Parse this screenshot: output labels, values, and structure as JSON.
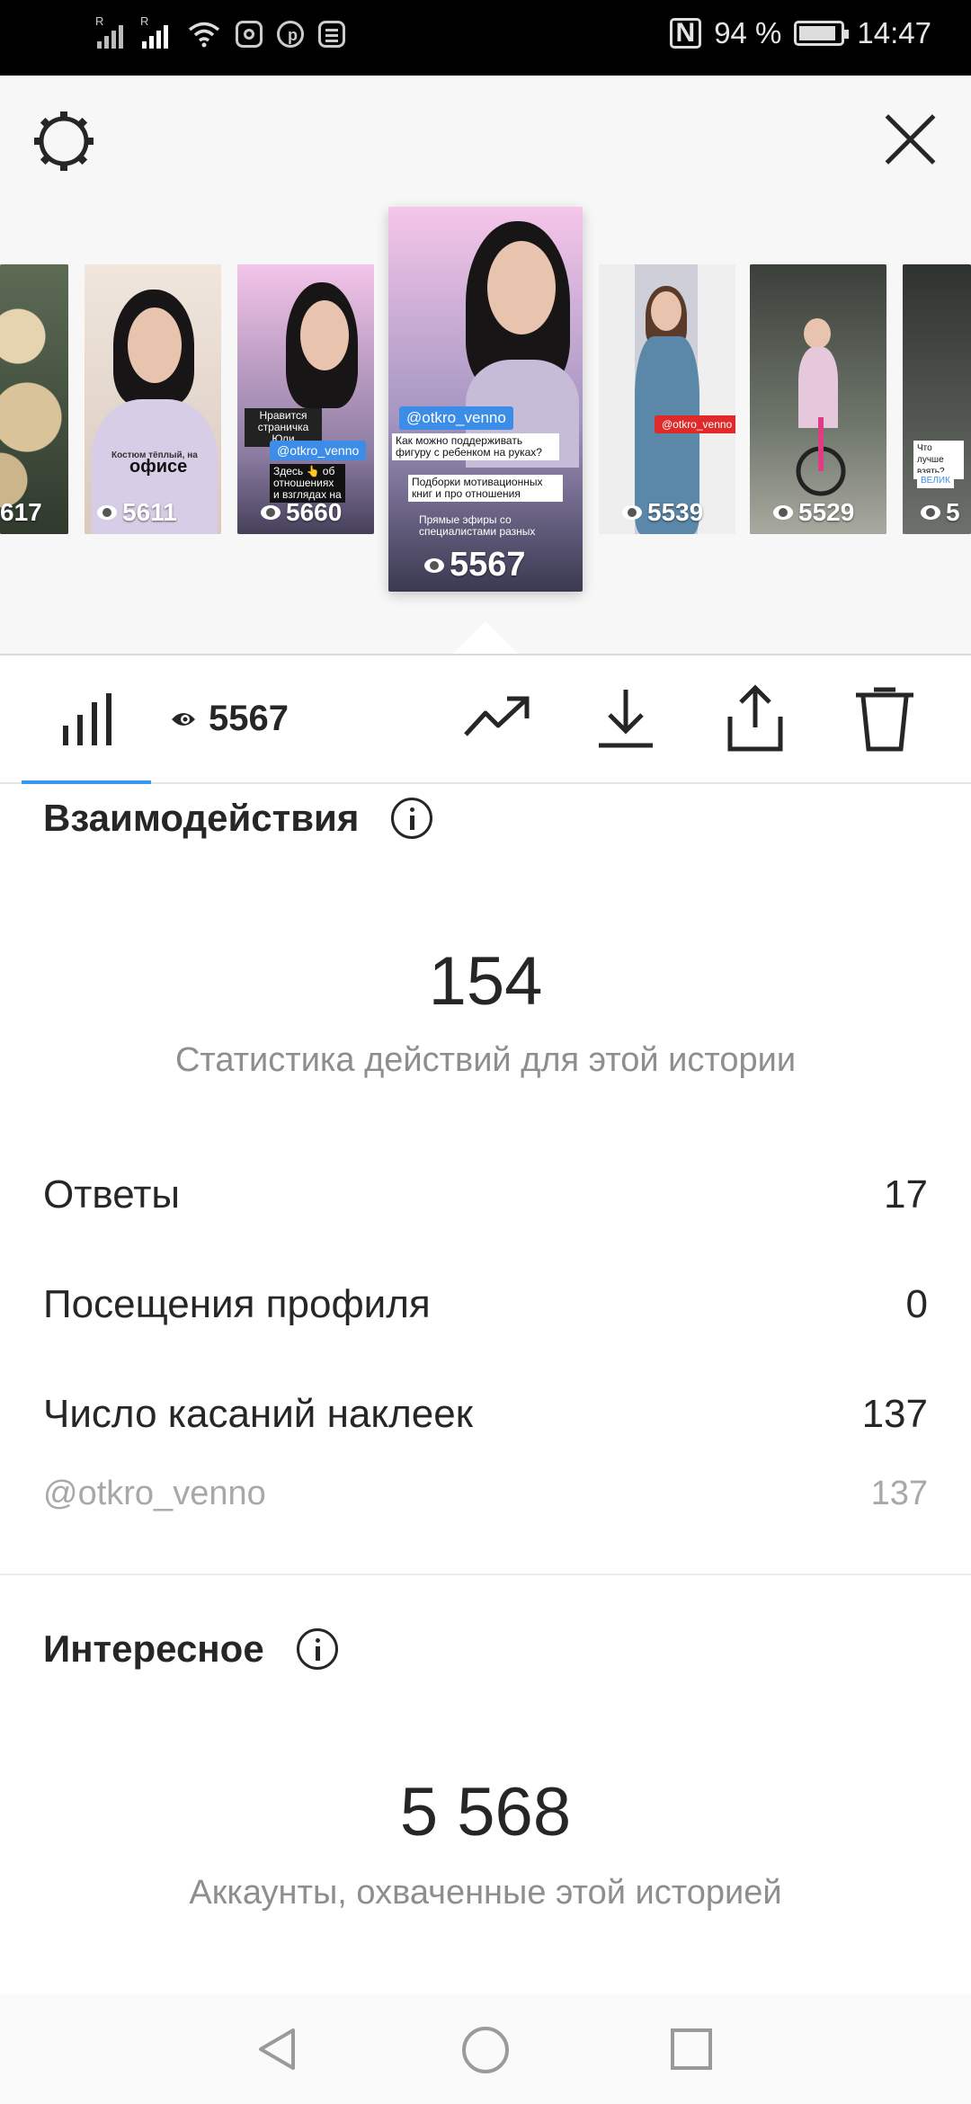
{
  "status_bar": {
    "battery": "94 %",
    "time": "14:47"
  },
  "stories": [
    {
      "views": "617"
    },
    {
      "views": "5611",
      "caption": "офисе",
      "small_text": "Костюм тёплый, на"
    },
    {
      "views": "5660",
      "caption1": "Нравится страничка Юли",
      "tag": "@otkro_venno",
      "caption2": "Здесь 👆 об отношениях и взглядах на"
    },
    {
      "views": "5567",
      "tag": "@otkro_venno",
      "caption1": "Как можно поддерживать фигуру с ребенком на руках?",
      "caption2": "Подборки мотивационных книг и про отношения",
      "caption3": "Прямые эфиры со специалистами разных"
    },
    {
      "views": "5539",
      "tag": "@otkro_venno"
    },
    {
      "views": "5529"
    },
    {
      "views": "5",
      "caption": "Что лучше взять?",
      "label": "ВЕЛИК"
    }
  ],
  "tabs": {
    "views_count": "5567"
  },
  "interactions": {
    "title": "Взаимодействия",
    "total": "154",
    "subtitle": "Статистика действий для этой истории",
    "rows": [
      {
        "label": "Ответы",
        "value": "17"
      },
      {
        "label": "Посещения профиля",
        "value": "0"
      },
      {
        "label": "Число касаний наклеек",
        "value": "137"
      }
    ],
    "sticker_row": {
      "label": "@otkro_venno",
      "value": "137"
    }
  },
  "discovery": {
    "title": "Интересное",
    "total": "5 568",
    "subtitle": "Аккаунты, охваченные этой историей"
  },
  "colors": {
    "accent": "#3897f0",
    "text": "#262626",
    "muted": "#8e8e8e"
  }
}
